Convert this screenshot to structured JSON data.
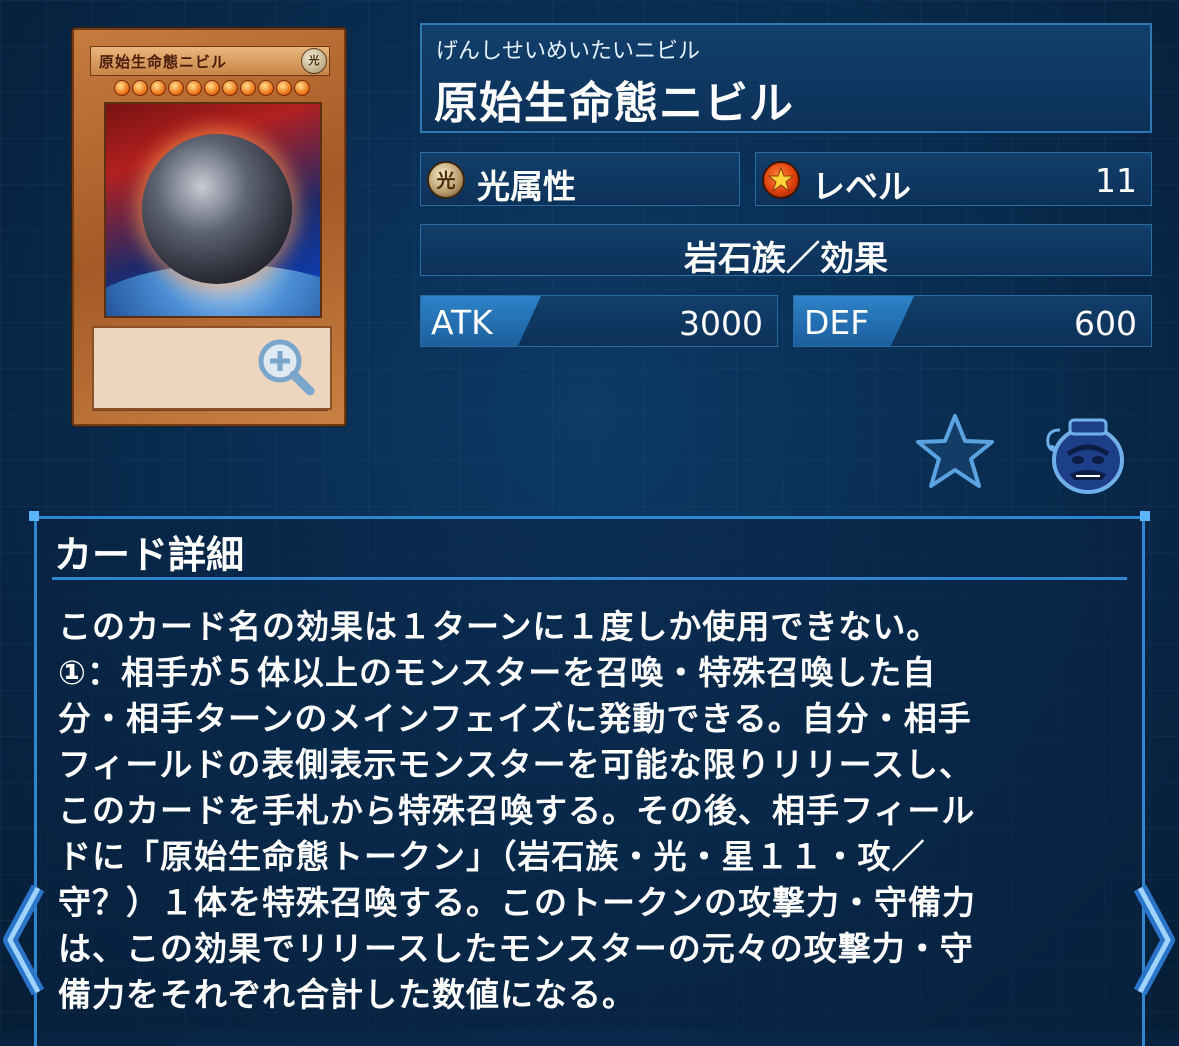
{
  "card": {
    "image_name": "原始生命態ニビル",
    "image_attribute_glyph": "光",
    "image_star_count": 11,
    "ruby": "げんしせいめいたいニビル",
    "name": "原始生命態ニビル",
    "attribute_icon_glyph": "光",
    "attribute": "光属性",
    "level_label": "レベル",
    "level": "11",
    "type": "岩石族／効果",
    "atk_label": "ATK",
    "atk": "3000",
    "def_label": "DEF",
    "def": "600"
  },
  "icons": {
    "zoom": "zoom-in-icon",
    "favorite": "star-icon",
    "pot": "pot-of-greed-icon",
    "prev": "chevron-left-icon",
    "next": "chevron-right-icon"
  },
  "detail": {
    "heading": "カード詳細",
    "lines": [
      "このカード名の効果は１ターンに１度しか使用できない。",
      "①：相手が５体以上のモンスターを召喚・特殊召喚した自",
      "分・相手ターンのメインフェイズに発動できる。自分・相手",
      "フィールドの表側表示モンスターを可能な限りリリースし、",
      "このカードを手札から特殊召喚する。その後、相手フィール",
      "ドに「原始生命態トークン」（岩石族・光・星１１・攻／",
      "守？）１体を特殊召喚する。このトークンの攻撃力・守備力",
      "は、この効果でリリースしたモンスターの元々の攻撃力・守",
      "備力をそれぞれ合計した数値になる。"
    ]
  },
  "colors": {
    "background": "#082a4c",
    "panel": "#0c3159",
    "accent": "#2f88cf",
    "stat_tag": "#2e82c8"
  }
}
